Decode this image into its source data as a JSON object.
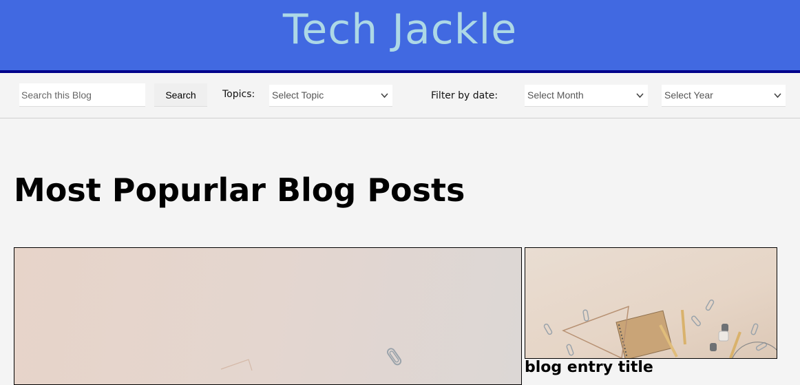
{
  "header": {
    "title": "Tech Jackle"
  },
  "toolbar": {
    "search_placeholder": "Search this Blog",
    "search_button": "Search",
    "topics_label": "Topics:",
    "topic_select": "Select Topic",
    "filter_label": "Filter by date:",
    "month_select": "Select Month",
    "year_select": "Select Year"
  },
  "main": {
    "section_title": "Most Popurlar Blog Posts",
    "posts": [
      {
        "title": ""
      },
      {
        "title": "blog entry title"
      }
    ]
  },
  "colors": {
    "header_bg": "#4169e1",
    "header_border": "#00008b",
    "title_color": "#add8e6",
    "page_bg": "#f4f4f4"
  }
}
